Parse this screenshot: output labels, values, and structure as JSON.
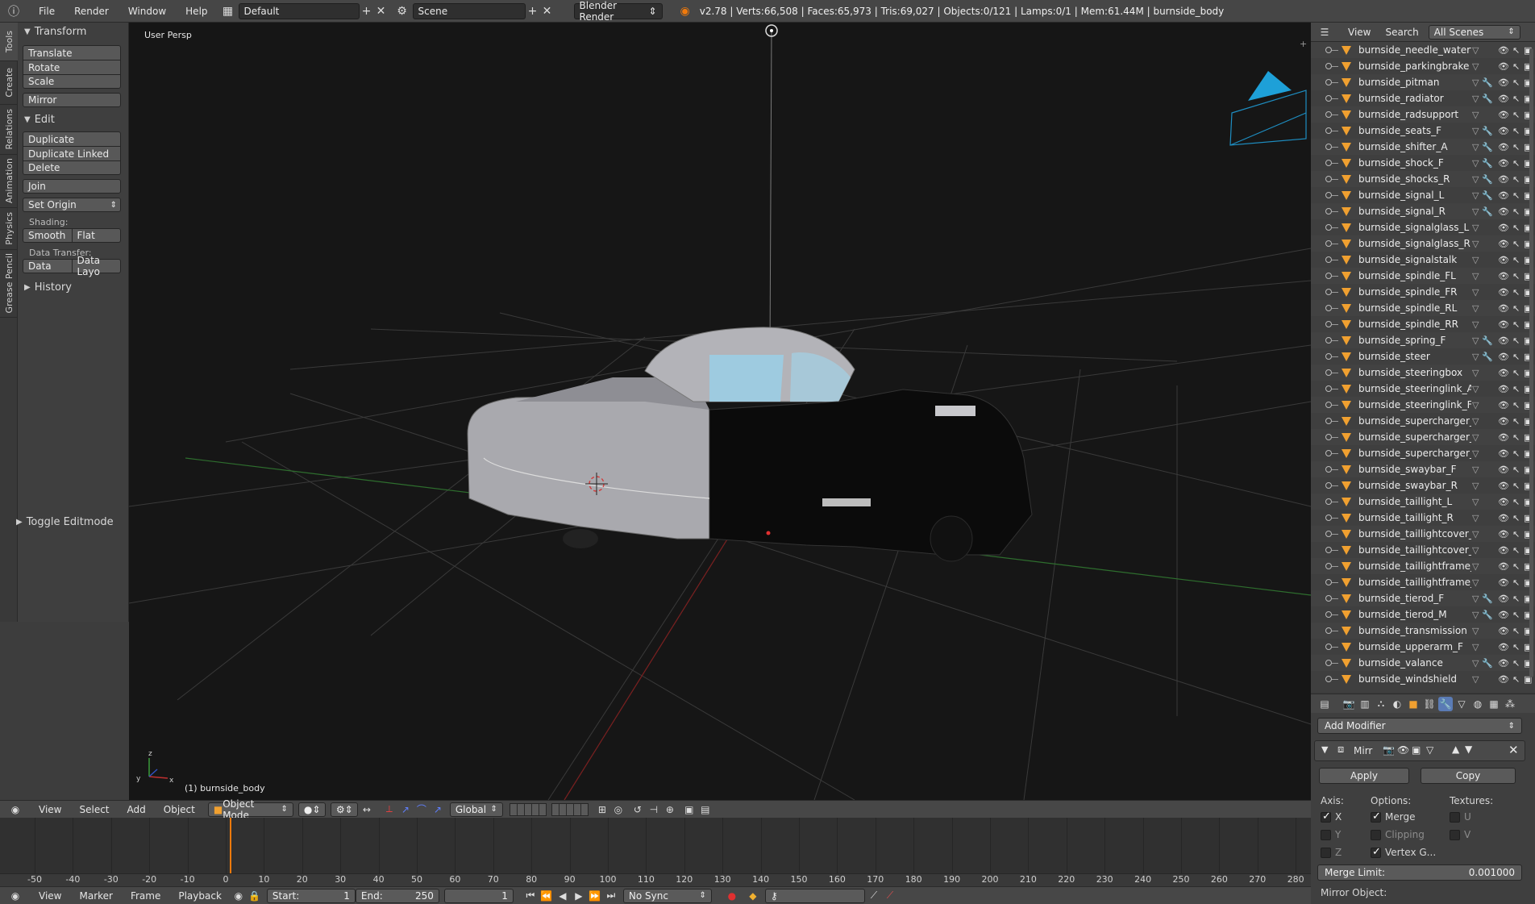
{
  "topbar": {
    "menus": [
      "File",
      "Render",
      "Window",
      "Help"
    ],
    "screen_layout": "Default",
    "scene": "Scene",
    "engine": "Blender Render",
    "stats": "v2.78 | Verts:66,508 | Faces:65,973 | Tris:69,027 | Objects:0/121 | Lamps:0/1 | Mem:61.44M | burnside_body"
  },
  "tooltabs": [
    "Tools",
    "Create",
    "Relations",
    "Animation",
    "Physics",
    "Grease Pencil"
  ],
  "toolshelf": {
    "transform": {
      "title": "Transform",
      "translate": "Translate",
      "rotate": "Rotate",
      "scale": "Scale",
      "mirror": "Mirror"
    },
    "edit": {
      "title": "Edit",
      "duplicate": "Duplicate",
      "duplicate_linked": "Duplicate Linked",
      "delete": "Delete",
      "join": "Join",
      "set_origin": "Set Origin",
      "shading_label": "Shading:",
      "smooth": "Smooth",
      "flat": "Flat",
      "data_transfer_label": "Data Transfer:",
      "data": "Data",
      "data_layout": "Data Layo"
    },
    "history": "History",
    "toggle_editmode": "Toggle Editmode"
  },
  "viewport": {
    "view_name": "User Persp",
    "active_object": "(1) burnside_body"
  },
  "viewport_header": {
    "menus": [
      "View",
      "Select",
      "Add",
      "Object"
    ],
    "mode": "Object Mode",
    "orientation": "Global"
  },
  "timeline": {
    "ticks": [
      "-50",
      "-40",
      "-30",
      "-20",
      "-10",
      "0",
      "10",
      "20",
      "30",
      "40",
      "50",
      "60",
      "70",
      "80",
      "90",
      "100",
      "110",
      "120",
      "130",
      "140",
      "150",
      "160",
      "170",
      "180",
      "190",
      "200",
      "210",
      "220",
      "230",
      "240",
      "250",
      "260",
      "270",
      "280"
    ],
    "current_frame": "1"
  },
  "timeline_header": {
    "menus": [
      "View",
      "Marker",
      "Frame",
      "Playback"
    ],
    "start_label": "Start:",
    "start_value": "1",
    "end_label": "End:",
    "end_value": "250",
    "frame": "1",
    "sync": "No Sync"
  },
  "outliner": {
    "menus": [
      "View",
      "Search"
    ],
    "filter": "All Scenes",
    "items": [
      "burnside_needle_watertemp",
      "burnside_parkingbrake",
      "burnside_pitman",
      "burnside_radiator",
      "burnside_radsupport",
      "burnside_seats_F",
      "burnside_shifter_A",
      "burnside_shock_F",
      "burnside_shocks_R",
      "burnside_signal_L",
      "burnside_signal_R",
      "burnside_signalglass_L",
      "burnside_signalglass_R",
      "burnside_signalstalk",
      "burnside_spindle_FL",
      "burnside_spindle_FR",
      "burnside_spindle_RL",
      "burnside_spindle_RR",
      "burnside_spring_F",
      "burnside_steer",
      "burnside_steeringbox",
      "burnside_steeringlink_A",
      "burnside_steeringlink_F",
      "burnside_supercharger_stage",
      "burnside_supercharger_stage",
      "burnside_supercharger_throt",
      "burnside_swaybar_F",
      "burnside_swaybar_R",
      "burnside_taillight_L",
      "burnside_taillight_R",
      "burnside_taillightcover_L",
      "burnside_taillightcover_R",
      "burnside_taillightframe_L",
      "burnside_taillightframe_R",
      "burnside_tierod_F",
      "burnside_tierod_M",
      "burnside_transmission",
      "burnside_upperarm_F",
      "burnside_valance",
      "burnside_windshield"
    ]
  },
  "properties": {
    "add_modifier": "Add Modifier",
    "modifier_name": "Mirr",
    "apply": "Apply",
    "copy": "Copy",
    "axis_label": "Axis:",
    "options_label": "Options:",
    "textures_label": "Textures:",
    "axis_x": "X",
    "axis_y": "Y",
    "axis_z": "Z",
    "merge": "Merge",
    "clipping": "Clipping",
    "vertex_groups": "Vertex G...",
    "tex_u": "U",
    "tex_v": "V",
    "merge_limit_label": "Merge Limit:",
    "merge_limit_value": "0.001000",
    "mirror_object_label": "Mirror Object:"
  },
  "colors": {
    "accent_orange": "#f07a0c",
    "object_icon": "#f0a030",
    "camera_blue": "#1ea0d8"
  }
}
